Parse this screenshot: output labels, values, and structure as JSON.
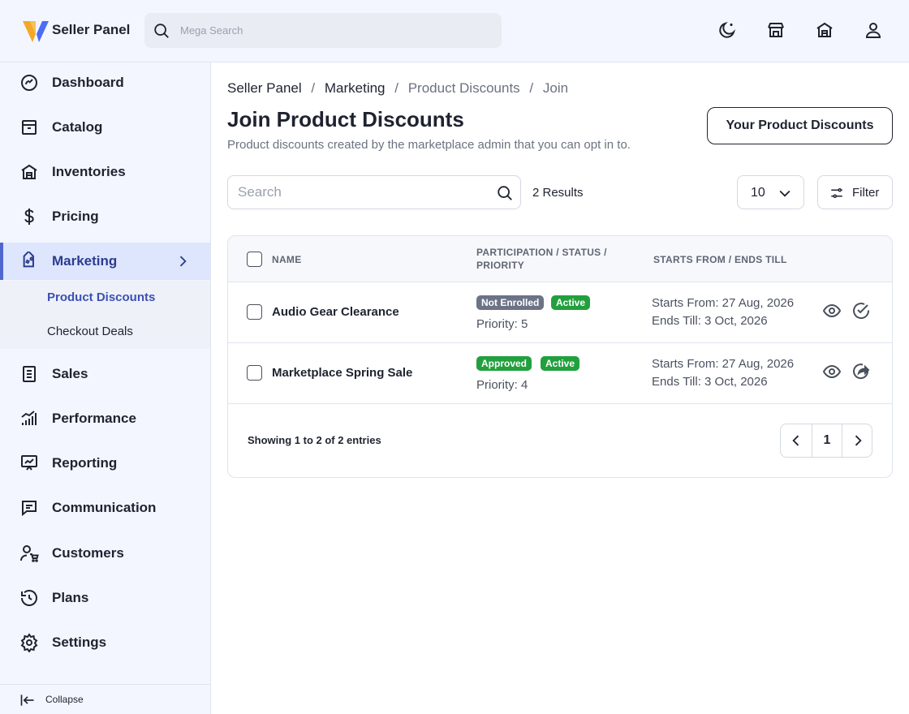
{
  "header": {
    "brand": "Seller Panel",
    "search_placeholder": "Mega Search",
    "icons": [
      "moon-icon",
      "store-icon",
      "warehouse-icon",
      "user-icon"
    ]
  },
  "sidebar": {
    "items": [
      {
        "label": "Dashboard",
        "icon": "dashboard-icon"
      },
      {
        "label": "Catalog",
        "icon": "catalog-icon"
      },
      {
        "label": "Inventories",
        "icon": "inventories-icon"
      },
      {
        "label": "Pricing",
        "icon": "dollar-icon"
      },
      {
        "label": "Marketing",
        "icon": "tag-icon"
      },
      {
        "label": "Sales",
        "icon": "sales-icon"
      },
      {
        "label": "Performance",
        "icon": "performance-icon"
      },
      {
        "label": "Reporting",
        "icon": "reporting-icon"
      },
      {
        "label": "Communication",
        "icon": "chat-icon"
      },
      {
        "label": "Customers",
        "icon": "customers-icon"
      },
      {
        "label": "Plans",
        "icon": "history-icon"
      },
      {
        "label": "Settings",
        "icon": "gear-icon"
      }
    ],
    "active": "Marketing",
    "submenu": [
      {
        "label": "Product Discounts",
        "active": true
      },
      {
        "label": "Checkout Deals",
        "active": false
      }
    ],
    "collapse_label": "Collapse"
  },
  "breadcrumb": [
    "Seller Panel",
    "Marketing",
    "Product Discounts",
    "Join"
  ],
  "page": {
    "title": "Join Product Discounts",
    "subtitle": "Product discounts created by the marketplace admin that you can opt in to.",
    "primary_button": "Your Product Discounts"
  },
  "toolbar": {
    "search_placeholder": "Search",
    "results": "2 Results",
    "per_page": "10",
    "filter_label": "Filter"
  },
  "table": {
    "headers": {
      "name": "NAME",
      "participation_1": "PARTICIPATION / STATUS /",
      "participation_2": "PRIORITY",
      "dates": "STARTS FROM / ENDS TILL"
    },
    "rows": [
      {
        "name": "Audio Gear Clearance",
        "participation": "Not Enrolled",
        "status": "Active",
        "priority": "Priority: 5",
        "starts": "Starts From: 27 Aug, 2026",
        "ends": "Ends Till: 3 Oct, 2026",
        "actions": [
          "eye-icon",
          "check-circle-icon"
        ]
      },
      {
        "name": "Marketplace Spring Sale",
        "participation": "Approved",
        "status": "Active",
        "priority": "Priority: 4",
        "starts": "Starts From: 27 Aug, 2026",
        "ends": "Ends Till: 3 Oct, 2026",
        "actions": [
          "eye-icon",
          "share-icon"
        ]
      }
    ],
    "showing": "Showing 1 to 2 of 2 entries",
    "current_page": "1"
  },
  "colors": {
    "accent": "#4e67cf",
    "active_bg": "#dde6fd",
    "logo_orange": "#f3a826",
    "logo_blue": "#4a6cf7",
    "badge_gray": "#6b7385",
    "badge_green": "#22a03e"
  }
}
